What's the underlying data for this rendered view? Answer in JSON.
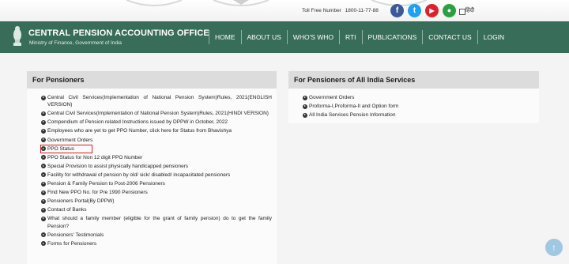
{
  "topbar": {
    "toll_free_label": "Toll Free Number",
    "toll_free_number": "1800-11-77-88",
    "social": [
      {
        "name": "facebook-icon",
        "glyph": "f",
        "color": "#3b5998"
      },
      {
        "name": "twitter-icon",
        "glyph": "t",
        "color": "#1da1f2"
      },
      {
        "name": "youtube-icon",
        "glyph": "▶",
        "color": "#d9232e"
      },
      {
        "name": "app-icon",
        "glyph": "●",
        "color": "#2e9e43"
      }
    ],
    "language": "हिंदी"
  },
  "header": {
    "title": "CENTRAL PENSION ACCOUNTING OFFICE",
    "subtitle": "Ministry of Finance, Government of India",
    "background": "#386d59"
  },
  "nav": [
    "HOME",
    "ABOUT US",
    "WHO'S WHO",
    "RTI",
    "PUBLICATIONS",
    "CONTACT US",
    "LOGIN"
  ],
  "left_panel": {
    "title": "For Pensioners",
    "links": [
      "Central Civil Services(Implementation of National Pension System)Rules, 2021(ENGLISH VERSION)",
      "Central Civil Services(Implementation of National Pension System)Rules, 2021(HINDI VERSION)",
      "Compendium of Pension related Instructions issued by DPPW in October, 2022",
      "Employees who are yet to get PPO Number, click here for Status from Bhavishya",
      "Government Orders",
      "PPO Status",
      "PPO Status for Non 12 digit PPO Number",
      "Special Provision to assist physically handicapped pensioners",
      "Facility for withdrawal of pension by old/ sick/ disabled/ incapacitated pensioners",
      "Pension & Family Pension to Post-2006 Pensioners",
      "Find New PPO No. for Pre 1990 Pensioners",
      "Pensioners Portal(By DPPW)",
      "Contact of Banks",
      "What should a family member (eligible for the grant of family pension) do to get the family Pension?",
      "Pensioners' Testimonials",
      "Forms for Pensioners"
    ],
    "highlighted_index": 5
  },
  "right_panel": {
    "title": "For Pensioners of All India Services",
    "links": [
      "Government Orders",
      "Proforma-I,Proforma-II and Option form",
      "All India Services Pension Information"
    ]
  },
  "scroll_top_icon": "arrow-up-icon"
}
